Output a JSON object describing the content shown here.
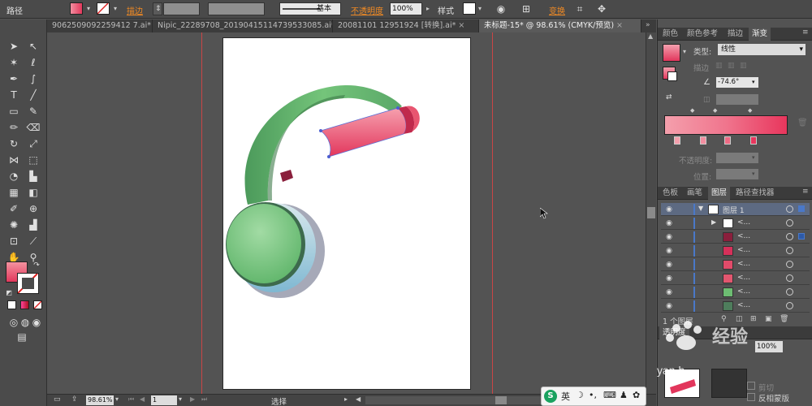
{
  "control_bar": {
    "object_type": "路径",
    "stroke_label": "描边",
    "opacity_label": "不透明度",
    "opacity_value": "100%",
    "style_label": "样式",
    "brush_label": "基本",
    "transform_label": "变换"
  },
  "tabs": [
    {
      "label": "9062509092259412 7.ai*",
      "active": false
    },
    {
      "label": "Nipic_22289708_20190415114739533085.ai*",
      "active": false
    },
    {
      "label": "20081101 12951924 [转换].ai*",
      "active": false
    },
    {
      "label": "未标题-15* @ 98.61% (CMYK/预览)",
      "active": true
    }
  ],
  "tab_close": "×",
  "panel_gradient": {
    "tabs": [
      "颜色",
      "颜色参考",
      "描边",
      "渐变"
    ],
    "active_tab": "渐变",
    "type_label": "类型:",
    "type_value": "线性",
    "stroke_label": "描边",
    "angle_value": "-74.6°",
    "opacity_label": "不透明度:",
    "position_label": "位置:",
    "gradient_start": "#f3909e",
    "gradient_end": "#e8365d"
  },
  "panel_layers": {
    "tabs": [
      "色板",
      "画笔",
      "图层",
      "路径查找器"
    ],
    "active_tab": "图层",
    "layer_name": "图层 1",
    "sublayer_label": "<...",
    "footer": "1 个图层",
    "rows": [
      {
        "thumb_color": "#ffffff"
      },
      {
        "thumb_color": "#8a1f3c"
      },
      {
        "thumb_color": "#d6305a"
      },
      {
        "thumb_color": "#e24b6a"
      },
      {
        "thumb_color": "#e2566f"
      },
      {
        "thumb_color": "#6dbd72"
      },
      {
        "thumb_color": "#4e7d5c"
      }
    ]
  },
  "panel_transparency": {
    "tab": "透明度",
    "value": "100%",
    "invert_label": "反相蒙版",
    "clip_label": "剪切"
  },
  "status_bar": {
    "zoom": "98.61%",
    "page": "1",
    "tool": "选择"
  },
  "ime": {
    "mode": "英"
  },
  "watermark": {
    "text": "yan.b"
  },
  "colors": {
    "fill": "#e94f6c",
    "stroke": "#ffffff",
    "headband_green": "#6dbd72",
    "cushion_blue": "#8cc0d6",
    "cup_red": "#e8365d",
    "guide_red": "#c94646"
  }
}
